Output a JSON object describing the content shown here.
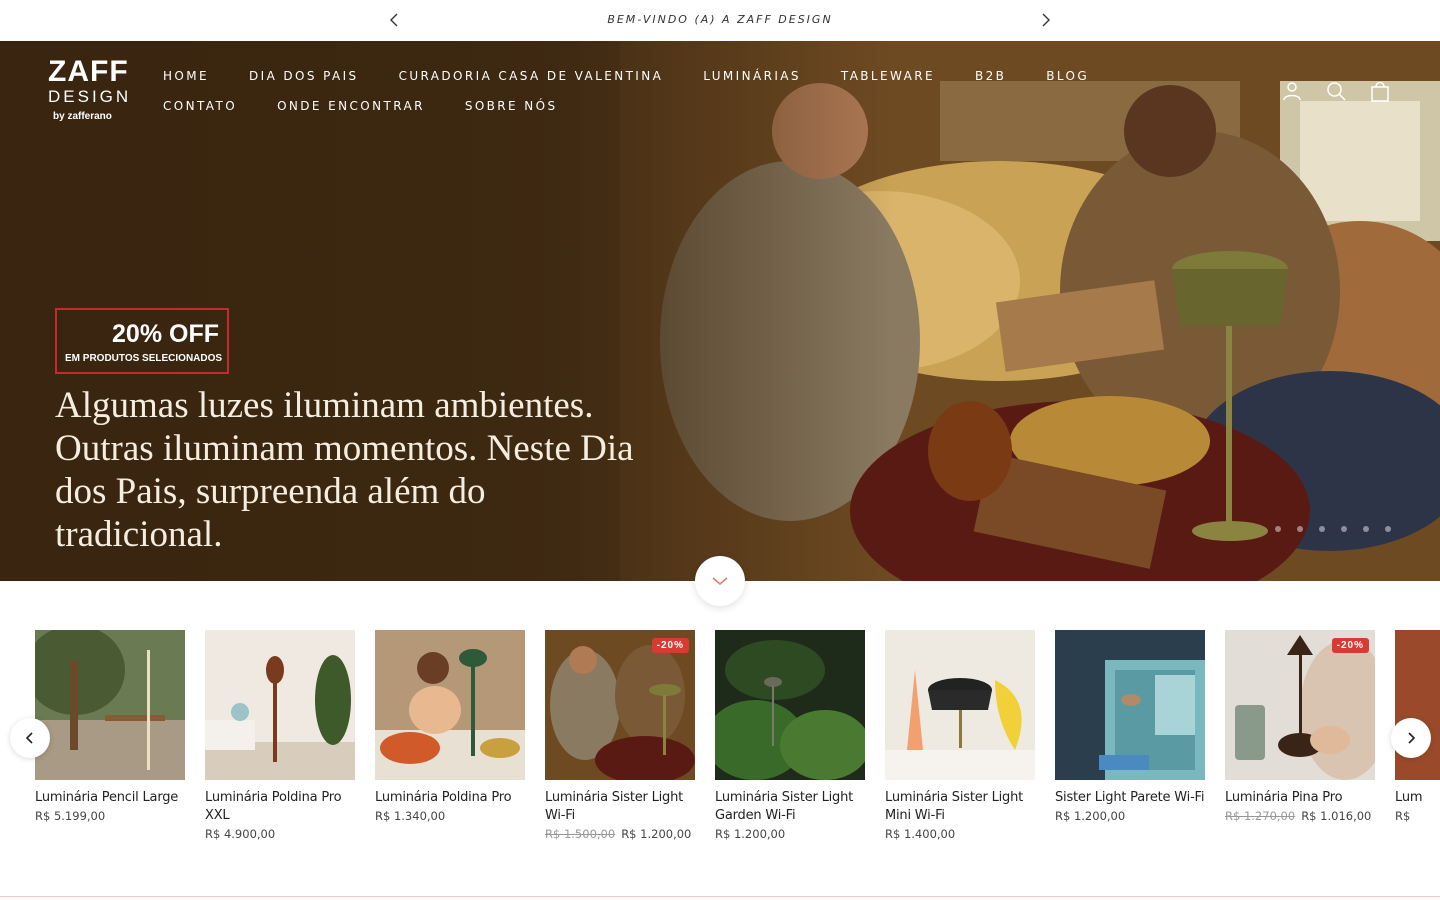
{
  "announcement": {
    "text": "BEM-VINDO (A) A ZAFF DESIGN"
  },
  "header": {
    "logo_line1": "ZAFF",
    "logo_line2": "DESIGN",
    "logo_line3": "by zafferano",
    "nav": [
      "HOME",
      "DIA DOS PAIS",
      "CURADORIA CASA DE VALENTINA",
      "LUMINÁRIAS",
      "TABLEWARE",
      "B2B",
      "BLOG",
      "CONTATO",
      "ONDE ENCONTRAR",
      "SOBRE NÓS"
    ],
    "icons": [
      "account-icon",
      "search-icon",
      "cart-icon"
    ]
  },
  "hero": {
    "badge_big": "20% OFF",
    "badge_small": "EM PRODUTOS SELECIONADOS",
    "headline": "Algumas luzes iluminam ambientes. Outras iluminam momentos. Neste Dia dos Pais, surpreenda além do tradicional.",
    "dot_count": 6
  },
  "products": [
    {
      "name": "Luminária Pencil Large",
      "price": "R$ 5.199,00",
      "old_price": "",
      "discount": ""
    },
    {
      "name": "Luminária Poldina Pro XXL",
      "price": "R$ 4.900,00",
      "old_price": "",
      "discount": ""
    },
    {
      "name": "Luminária Poldina Pro",
      "price": "R$ 1.340,00",
      "old_price": "",
      "discount": ""
    },
    {
      "name": "Luminária Sister Light Wi-Fi",
      "price": "R$ 1.200,00",
      "old_price": "R$ 1.500,00",
      "discount": "-20%"
    },
    {
      "name": "Luminária Sister Light Garden Wi-Fi",
      "price": "R$ 1.200,00",
      "old_price": "",
      "discount": ""
    },
    {
      "name": "Luminária Sister Light Mini Wi-Fi",
      "price": "R$ 1.400,00",
      "old_price": "",
      "discount": ""
    },
    {
      "name": "Sister Light Parete Wi-Fi",
      "price": "R$ 1.200,00",
      "old_price": "",
      "discount": ""
    },
    {
      "name": "Luminária Pina Pro",
      "price": "R$ 1.016,00",
      "old_price": "R$ 1.270,00",
      "discount": "-20%"
    },
    {
      "name": "Lum",
      "price": "R$",
      "old_price": "",
      "discount": ""
    }
  ],
  "colors": {
    "hero_brown": "#3a2612",
    "badge_red": "#c8282f",
    "discount_red": "#d83a34"
  }
}
